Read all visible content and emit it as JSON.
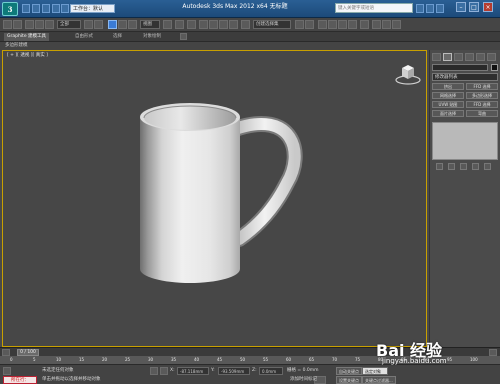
{
  "app": {
    "logo_label": "3",
    "workspace": "工作台：默认",
    "title": "Autodesk 3ds Max  2012 x64     无标题",
    "search_placeholder": "键入关键字或短语",
    "window_buttons": [
      "–",
      "□",
      "×"
    ]
  },
  "ribbon": {
    "tabs": [
      "Graphite 建模工具",
      "自由形式",
      "选择",
      "对象绘制"
    ],
    "active_index": 0,
    "sub_label": "多边形建模"
  },
  "toolbar": {
    "selection_filter": "全部",
    "view_dropdown": "视图",
    "named_selection": "创建选择集"
  },
  "viewport": {
    "label": "[ + ][ 透视 ][ 真实 ]",
    "border_color": "#c8a000",
    "object": "mug",
    "viewcube_icon": "viewcube-icon"
  },
  "command_panel": {
    "tab_icons": [
      "create-icon",
      "modify-icon",
      "hierarchy-icon",
      "motion-icon",
      "display-icon",
      "utilities-icon"
    ],
    "active_tab": 1,
    "modifier_list": "修改器列表",
    "buttons": [
      [
        "挤出",
        "FFD 选择"
      ],
      [
        "网格选择",
        "多边形选择"
      ],
      [
        "UVW 贴图",
        "FFD 选择"
      ],
      [
        "面片选择",
        "弯曲"
      ]
    ],
    "stack_tool_icons": [
      "pin-stack-icon",
      "show-end-result-icon",
      "make-unique-icon",
      "remove-modifier-icon",
      "configure-sets-icon"
    ]
  },
  "timeline": {
    "frame_display": "0 / 100",
    "ticks": [
      "0",
      "5",
      "10",
      "15",
      "20",
      "25",
      "30",
      "35",
      "40",
      "45",
      "50",
      "55",
      "60",
      "65",
      "70",
      "75",
      "80",
      "85",
      "90",
      "95",
      "100"
    ]
  },
  "status": {
    "script_badge": "所在行：",
    "line1": "未选定任何对象",
    "line2": "单击并拖动以选择并移动对象",
    "x_label": "X:",
    "x_value": "-87.118mm",
    "y_label": "Y:",
    "y_value": "-93.509mm",
    "z_label": "Z:",
    "z_value": "0.0mm",
    "grid": "栅格 = 0.0mm",
    "autokey": "自动关键点",
    "setkey": "设置关键点",
    "selected_dropdown": "选定对象",
    "add_time_tag": "添加时间标记",
    "key_filters": "关键点过滤器..."
  },
  "watermark": {
    "brand": "Bai 经验",
    "url": "jingyan.baidu.com"
  },
  "colors": {
    "titlebar": "#1c4a7a",
    "viewport_bg": "#474747",
    "accent": "#3a7bd5",
    "status_badge": "#c11"
  }
}
